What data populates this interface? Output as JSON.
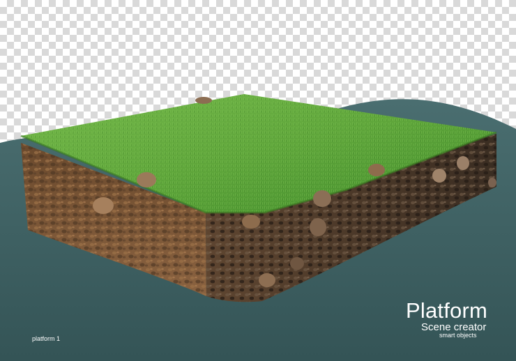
{
  "title": "Platform",
  "subtitle": "Scene creator",
  "tagline": "smart objects",
  "label": "platform 1",
  "colors": {
    "backdrop": "#3f6365",
    "grass": "#5fa83e",
    "soil": "#7a5332"
  }
}
